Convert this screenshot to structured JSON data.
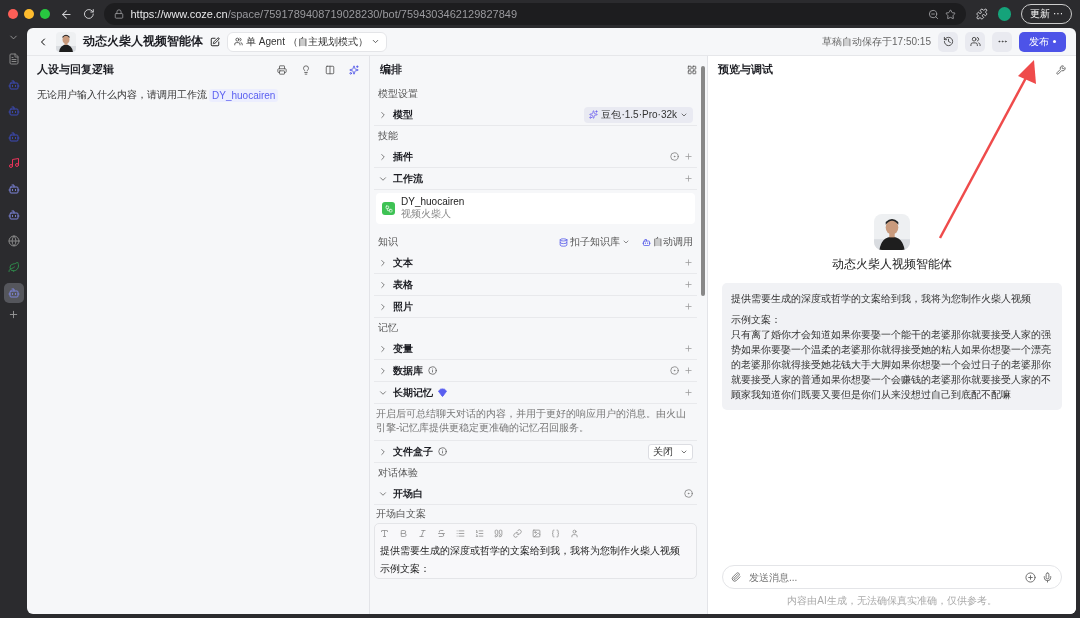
{
  "browser": {
    "url_host": "https://www.coze.cn",
    "url_path": "/space/7591789408719028230/bot/7594303462129827849",
    "update_button": "更新 ···"
  },
  "rail": {
    "apps": [
      {
        "kind": "doc",
        "selected": false
      },
      {
        "kind": "blob",
        "selected": false
      },
      {
        "kind": "blob",
        "selected": false
      },
      {
        "kind": "blob",
        "selected": false
      },
      {
        "kind": "music",
        "selected": false
      },
      {
        "kind": "bot",
        "selected": false
      },
      {
        "kind": "bot",
        "selected": false
      },
      {
        "kind": "globe",
        "selected": false
      },
      {
        "kind": "leaf",
        "selected": false
      },
      {
        "kind": "bot",
        "selected": true
      }
    ]
  },
  "header": {
    "bot_name": "动态火柴人视频智能体",
    "mode": "单 Agent （自主规划模式）",
    "saved": "草稿自动保存于17:50:15",
    "publish": "发布"
  },
  "persona": {
    "title": "人设与回复逻辑",
    "prompt": "无论用户输入什么内容，请调用工作流",
    "workflow_chip": "DY_huocairen"
  },
  "arrange": {
    "title": "编排",
    "sections": [
      {
        "title": "模型设置",
        "items": [
          {
            "kind": "row",
            "label": "模型",
            "expanded": false,
            "model": "豆包·1.5·Pro·32k"
          }
        ]
      },
      {
        "title": "技能",
        "items": [
          {
            "kind": "row",
            "label": "插件",
            "expanded": false,
            "auto": true,
            "add": true
          },
          {
            "kind": "row",
            "label": "工作流",
            "expanded": true,
            "add": true
          },
          {
            "kind": "card",
            "name": "DY_huocairen",
            "desc": "视频火柴人"
          }
        ]
      },
      {
        "title": "知识",
        "source": "扣子知识库",
        "call_mode": "自动调用",
        "items": [
          {
            "kind": "row",
            "label": "文本",
            "expanded": false,
            "add": true
          },
          {
            "kind": "row",
            "label": "表格",
            "expanded": false,
            "add": true
          },
          {
            "kind": "row",
            "label": "照片",
            "expanded": false,
            "add": true
          }
        ]
      },
      {
        "title": "记忆",
        "items": [
          {
            "kind": "row",
            "label": "变量",
            "expanded": false,
            "add": true
          },
          {
            "kind": "row",
            "label": "数据库",
            "expanded": false,
            "info": true,
            "auto": true,
            "add": true
          },
          {
            "kind": "row",
            "label": "长期记忆",
            "expanded": true,
            "premium": true,
            "add": true
          },
          {
            "kind": "note",
            "text": "开启后可总结聊天对话的内容，并用于更好的响应用户的消息。由火山引擎-记忆库提供更稳定更准确的记忆召回服务。"
          },
          {
            "kind": "row",
            "label": "文件盒子",
            "expanded": false,
            "info": true,
            "select": "关闭"
          }
        ]
      },
      {
        "title": "对话体验",
        "items": [
          {
            "kind": "row",
            "label": "开场白",
            "expanded": true,
            "auto": true
          },
          {
            "kind": "editor",
            "label": "开场白文案",
            "lines": [
              "提供需要生成的深度或哲学的文案给到我，我将为您制作火柴人视频",
              "示例文案："
            ]
          }
        ]
      }
    ]
  },
  "preview": {
    "title": "预览与调试",
    "bot_name": "动态火柴人视频智能体",
    "message": [
      "提供需要生成的深度或哲学的文案给到我，我将为您制作火柴人视频",
      "示例文案：",
      "只有离了婚你才会知道如果你要娶一个能干的老婆那你就要接受人家的强势如果你要娶一个温柔的老婆那你就得接受她的粘人如果你想娶一个漂亮的老婆那你就得接受她花钱大手大脚如果你想娶一个会过日子的老婆那你就要接受人家的普通如果你想娶一个会赚钱的老婆那你就要接受人家的不顾家我知道你们既要又要但是你们从来没想过自己到底配不配嘛"
    ],
    "input_placeholder": "发送消息...",
    "disclaimer": "内容由AI生成，无法确保真实准确，仅供参考。"
  }
}
